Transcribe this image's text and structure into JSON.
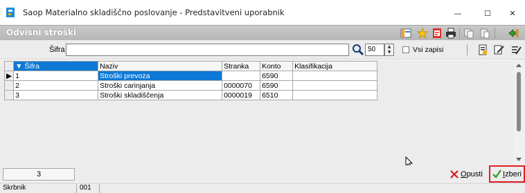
{
  "window": {
    "title": "Saop Materialno skladiščno poslovanje - Predstavitveni uporabnik",
    "minimize_glyph": "—",
    "maximize_glyph": "☐",
    "close_glyph": "✕"
  },
  "section": {
    "title": "Odvisni stroški"
  },
  "toolbar": {
    "icons": [
      "layout-icon",
      "favorite-star-icon",
      "pdf-export-icon",
      "print-icon",
      "copy-icon",
      "paste-icon",
      "exit-icon",
      "new-document-icon",
      "edit-document-icon",
      "edit-list-icon"
    ]
  },
  "filter": {
    "sifra_label": "Šifra",
    "sifra_value": "",
    "limit_value": "50",
    "vsi_zapisi_label": "Vsi zapisi",
    "vsi_zapisi_checked": false
  },
  "grid": {
    "columns": [
      "▼ Šifra",
      "Naziv",
      "Stranka",
      "Konto",
      "Klasifikacija"
    ],
    "rows": [
      {
        "sifra": "1",
        "naziv": "Stroški prevoza",
        "stranka": "",
        "konto": "6590",
        "klasifikacija": "",
        "selected": true
      },
      {
        "sifra": "2",
        "naziv": "Stroški carinjanja",
        "stranka": "0000070",
        "konto": "6590",
        "klasifikacija": "",
        "selected": false
      },
      {
        "sifra": "3",
        "naziv": "Stroški skladiščenja",
        "stranka": "0000019",
        "konto": "6510",
        "klasifikacija": "",
        "selected": false
      }
    ]
  },
  "footer": {
    "record_count": "3",
    "cancel_label_first": "O",
    "cancel_label_rest": "pusti",
    "select_label_first": "I",
    "select_label_rest": "zberi"
  },
  "status": {
    "user": "Skrbnik",
    "code": "001"
  },
  "colors": {
    "accent": "#0d78d6",
    "toolbar_bg": "#bdbdbd",
    "highlight_border": "#e02020",
    "ok_green": "#2a9a2a",
    "cancel_red": "#d02020"
  }
}
